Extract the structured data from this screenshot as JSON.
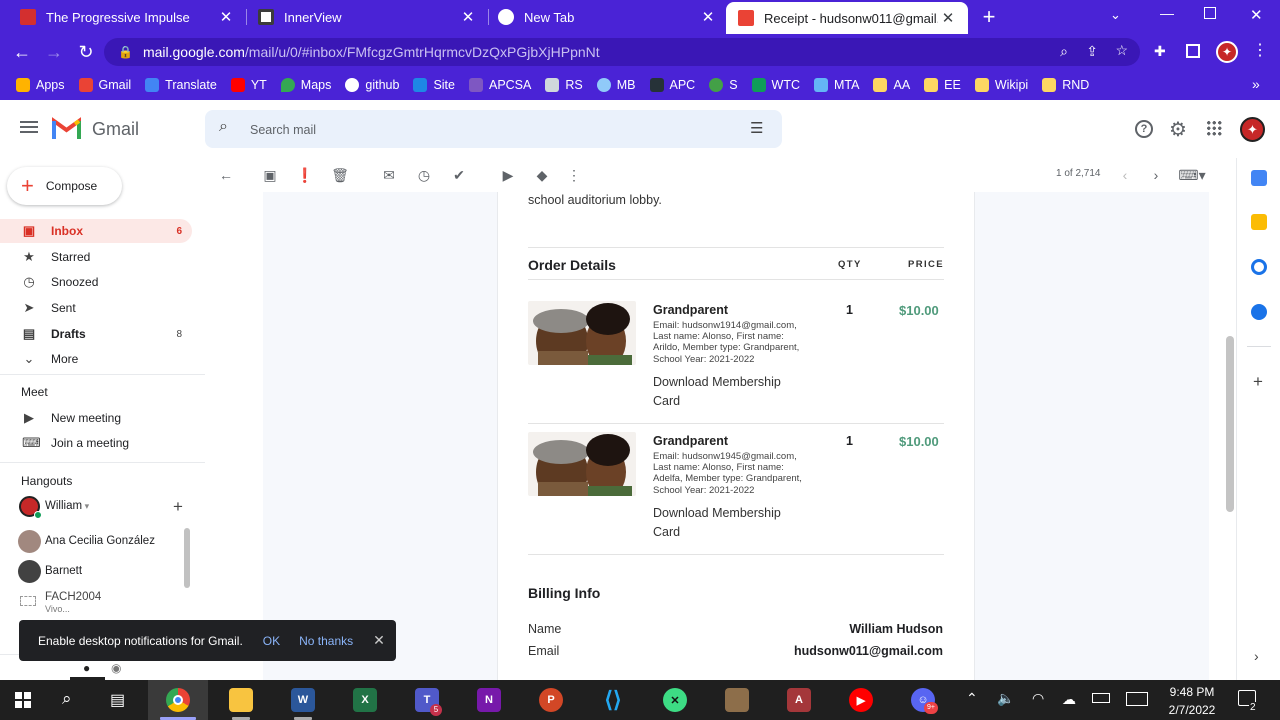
{
  "browser": {
    "tabs": [
      {
        "title": "The Progressive Impulse",
        "favicon_color": "#d32f2f"
      },
      {
        "title": "InnerView",
        "favicon_color": "#3c3c3c"
      },
      {
        "title": "New Tab",
        "favicon_color": "#ffffff"
      },
      {
        "title": "Receipt - hudsonw011@gmail.co",
        "favicon_color": "#ea4335"
      }
    ],
    "url_host": "mail.google.com",
    "url_path": "/mail/u/0/#inbox/FMfcgzGmtrHqrmcvDzQxPGjbXjHPpnNt",
    "bookmarks": [
      "Apps",
      "Gmail",
      "Translate",
      "YT",
      "Maps",
      "github",
      "Site",
      "APCSA",
      "RS",
      "MB",
      "APC",
      "S",
      "WTC",
      "MTA",
      "AA",
      "EE",
      "Wikipi",
      "RND"
    ],
    "bookmarks_more": "»"
  },
  "gmail": {
    "logo_text": "Gmail",
    "search_placeholder": "Search mail",
    "compose_label": "Compose",
    "nav": [
      {
        "label": "Inbox",
        "count": "6",
        "icon": "inbox-icon",
        "glyph": "▣"
      },
      {
        "label": "Starred",
        "count": "",
        "icon": "star-icon",
        "glyph": "★"
      },
      {
        "label": "Snoozed",
        "count": "",
        "icon": "clock-icon",
        "glyph": "◷"
      },
      {
        "label": "Sent",
        "count": "",
        "icon": "send-icon",
        "glyph": "➤"
      },
      {
        "label": "Drafts",
        "count": "8",
        "icon": "draft-icon",
        "glyph": "▤"
      },
      {
        "label": "More",
        "count": "",
        "icon": "chevron-down-icon",
        "glyph": "⌄"
      }
    ],
    "meet": {
      "heading": "Meet",
      "new_meeting": "New meeting",
      "join_meeting": "Join a meeting"
    },
    "hangouts": {
      "heading": "Hangouts",
      "self": "William",
      "contacts": [
        {
          "name": "Ana Cecilia González",
          "sub": ""
        },
        {
          "name": "Barnett",
          "sub": ""
        },
        {
          "name": "FACH2004",
          "sub": "Vivo..."
        }
      ]
    },
    "pagination": "1 of 2,714"
  },
  "email": {
    "intro_tail": "school auditorium lobby.",
    "order_heading": "Order Details",
    "qty_header": "QTY",
    "price_header": "PRICE",
    "items": [
      {
        "name": "Grandparent",
        "desc": "Email: hudsonw1914@gmail.com, Last name: Alonso, First name: Arildo, Member type: Grandparent, School Year: 2021-2022",
        "link": "Download Membership Card",
        "qty": "1",
        "price": "$10.00"
      },
      {
        "name": "Grandparent",
        "desc": "Email: hudsonw1945@gmail.com, Last name: Alonso, First name: Adelfa, Member type: Grandparent, School Year: 2021-2022",
        "link": "Download Membership Card",
        "qty": "1",
        "price": "$10.00"
      }
    ],
    "billing_heading": "Billing Info",
    "billing": [
      {
        "label": "Name",
        "value": "William Hudson"
      },
      {
        "label": "Email",
        "value": "hudsonw011@gmail.com"
      }
    ]
  },
  "toast": {
    "message": "Enable desktop notifications for Gmail.",
    "ok": "OK",
    "no_thanks": "No thanks"
  },
  "taskbar": {
    "time": "9:48 PM",
    "date": "2/7/2022",
    "notifications": "2",
    "teams_badge": "5",
    "discord_badge": "9+"
  },
  "colors": {
    "chrome_purple": "#4a23d6",
    "accent_red": "#d93025",
    "price_green": "#4f9a7b"
  }
}
